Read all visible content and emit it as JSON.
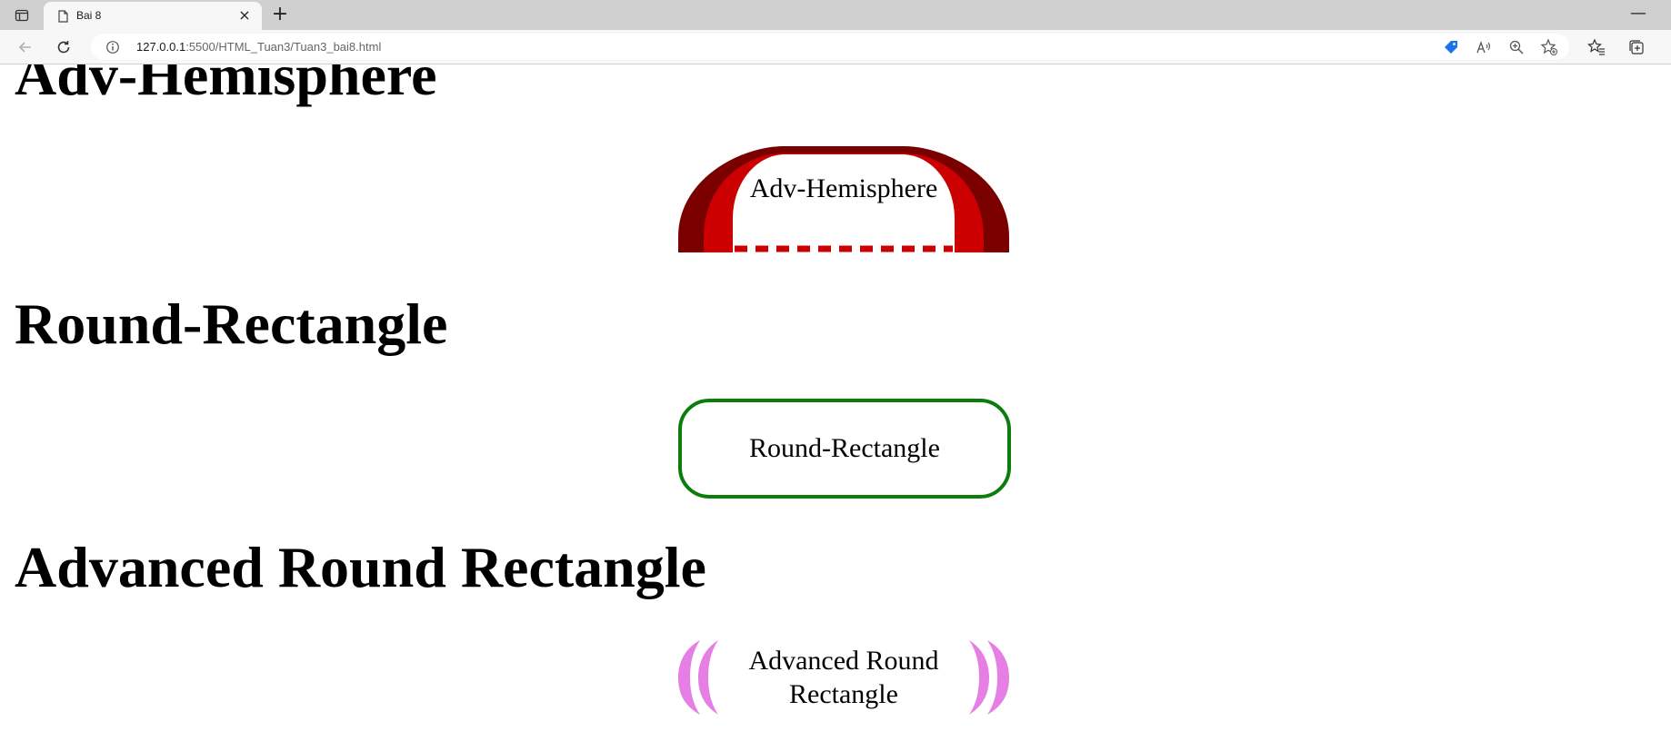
{
  "browser": {
    "tab_title": "Bai 8",
    "tab_close": "×",
    "new_tab": "+",
    "minimize": "—",
    "url_host": "127.0.0.1",
    "url_rest": ":5500/HTML_Tuan3/Tuan3_bai8.html",
    "icons": {
      "tab_actions": "tab-actions-icon",
      "favicon": "page-icon",
      "back": "back-arrow-icon",
      "reload": "reload-icon",
      "site_info": "info-icon",
      "shopping": "tag-icon",
      "read_aloud": "read-aloud-icon",
      "zoom": "zoom-icon",
      "add_favorite": "add-favorite-icon",
      "favorites": "favorites-icon",
      "collections": "collections-icon"
    }
  },
  "page": {
    "sections": [
      {
        "heading": "Adv-Hemisphere",
        "label": "Adv-Hemisphere",
        "colors": {
          "outer": "#7a0000",
          "inner": "#cc0000",
          "dash": "#cc0000"
        }
      },
      {
        "heading": "Round-Rectangle",
        "label": "Round-Rectangle",
        "colors": {
          "border": "#0a7d0a"
        }
      },
      {
        "heading": "Advanced Round Rectangle",
        "label_line1": "Advanced Round",
        "label_line2": "Rectangle",
        "colors": {
          "brackets": "#e57ee5"
        }
      }
    ]
  }
}
